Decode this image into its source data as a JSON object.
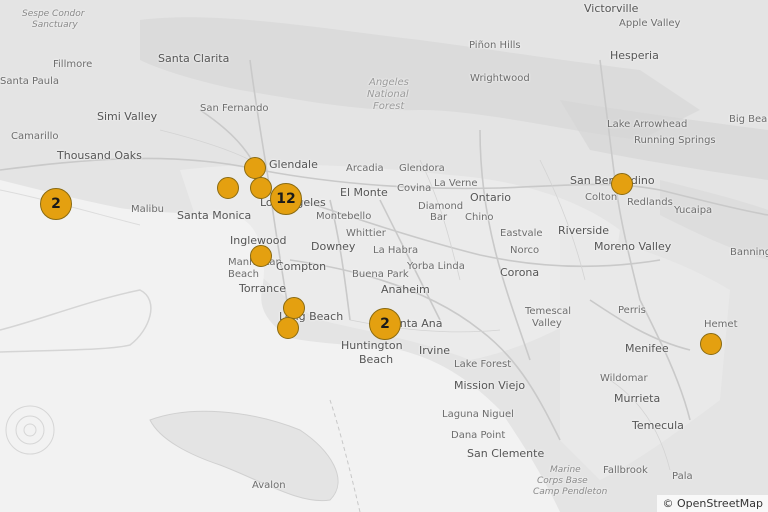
{
  "map": {
    "attribution": "© OpenStreetMap",
    "colors": {
      "land": "#e3e3e3",
      "water": "#f2f2f2",
      "marker_fill": "#e4a010",
      "marker_border": "#8a6a10"
    },
    "labels": [
      {
        "id": "sespe-condor",
        "text": "Sespe Condor"
      },
      {
        "id": "sanctuary",
        "text": "Sanctuary"
      },
      {
        "id": "fillmore",
        "text": "Fillmore"
      },
      {
        "id": "santa-paula",
        "text": "Santa Paula"
      },
      {
        "id": "santa-clarita",
        "text": "Santa Clarita"
      },
      {
        "id": "pinon-hills",
        "text": "Piñon Hills"
      },
      {
        "id": "victorville",
        "text": "Victorville"
      },
      {
        "id": "apple-valley",
        "text": "Apple Valley"
      },
      {
        "id": "hesperia",
        "text": "Hesperia"
      },
      {
        "id": "wrightwood",
        "text": "Wrightwood"
      },
      {
        "id": "angeles",
        "text": "Angeles"
      },
      {
        "id": "national",
        "text": "National"
      },
      {
        "id": "forest",
        "text": "Forest"
      },
      {
        "id": "simi-valley",
        "text": "Simi Valley"
      },
      {
        "id": "san-fernando",
        "text": "San Fernando"
      },
      {
        "id": "camarillo",
        "text": "Camarillo"
      },
      {
        "id": "lake-arrowhead",
        "text": "Lake Arrowhead"
      },
      {
        "id": "big-bear",
        "text": "Big Bear"
      },
      {
        "id": "running-springs",
        "text": "Running Springs"
      },
      {
        "id": "thousand-oaks",
        "text": "Thousand Oaks"
      },
      {
        "id": "glendale",
        "text": "Glendale"
      },
      {
        "id": "arcadia",
        "text": "Arcadia"
      },
      {
        "id": "glendora",
        "text": "Glendora"
      },
      {
        "id": "covina",
        "text": "Covina"
      },
      {
        "id": "la-verne",
        "text": "La Verne"
      },
      {
        "id": "el-monte",
        "text": "El Monte"
      },
      {
        "id": "ontario",
        "text": "Ontario"
      },
      {
        "id": "san-bernardino",
        "text": "San Bernardino"
      },
      {
        "id": "colton",
        "text": "Colton"
      },
      {
        "id": "redlands",
        "text": "Redlands"
      },
      {
        "id": "yucaipa",
        "text": "Yucaipa"
      },
      {
        "id": "malibu",
        "text": "Malibu"
      },
      {
        "id": "santa-monica",
        "text": "Santa Monica"
      },
      {
        "id": "los-angeles",
        "text": "Los Angeles"
      },
      {
        "id": "montebello",
        "text": "Montebello"
      },
      {
        "id": "diamond",
        "text": "Diamond"
      },
      {
        "id": "bar",
        "text": "Bar"
      },
      {
        "id": "chino",
        "text": "Chino"
      },
      {
        "id": "eastvale",
        "text": "Eastvale"
      },
      {
        "id": "riverside",
        "text": "Riverside"
      },
      {
        "id": "moreno-valley",
        "text": "Moreno Valley"
      },
      {
        "id": "banning",
        "text": "Banning"
      },
      {
        "id": "inglewood",
        "text": "Inglewood"
      },
      {
        "id": "downey",
        "text": "Downey"
      },
      {
        "id": "whittier",
        "text": "Whittier"
      },
      {
        "id": "la-habra",
        "text": "La Habra"
      },
      {
        "id": "norco",
        "text": "Norco"
      },
      {
        "id": "manhattan",
        "text": "Manhattan"
      },
      {
        "id": "beach-1",
        "text": "Beach"
      },
      {
        "id": "compton",
        "text": "Compton"
      },
      {
        "id": "buena-park",
        "text": "Buena Park"
      },
      {
        "id": "yorba-linda",
        "text": "Yorba Linda"
      },
      {
        "id": "corona",
        "text": "Corona"
      },
      {
        "id": "torrance",
        "text": "Torrance"
      },
      {
        "id": "anaheim",
        "text": "Anaheim"
      },
      {
        "id": "long-beach",
        "text": "Long Beach"
      },
      {
        "id": "santa-ana",
        "text": "Santa Ana"
      },
      {
        "id": "temescal",
        "text": "Temescal"
      },
      {
        "id": "valley",
        "text": "Valley"
      },
      {
        "id": "perris",
        "text": "Perris"
      },
      {
        "id": "hemet",
        "text": "Hemet"
      },
      {
        "id": "huntington",
        "text": "Huntington"
      },
      {
        "id": "beach-2",
        "text": "Beach"
      },
      {
        "id": "irvine",
        "text": "Irvine"
      },
      {
        "id": "lake-forest",
        "text": "Lake Forest"
      },
      {
        "id": "menifee",
        "text": "Menifee"
      },
      {
        "id": "mission-viejo",
        "text": "Mission Viejo"
      },
      {
        "id": "wildomar",
        "text": "Wildomar"
      },
      {
        "id": "murrieta",
        "text": "Murrieta"
      },
      {
        "id": "laguna-niguel",
        "text": "Laguna Niguel"
      },
      {
        "id": "temecula",
        "text": "Temecula"
      },
      {
        "id": "dana-point",
        "text": "Dana Point"
      },
      {
        "id": "san-clemente",
        "text": "San Clemente"
      },
      {
        "id": "marine",
        "text": "Marine"
      },
      {
        "id": "corps-base",
        "text": "Corps Base"
      },
      {
        "id": "camp-pendleton",
        "text": "Camp Pendleton"
      },
      {
        "id": "fallbrook",
        "text": "Fallbrook"
      },
      {
        "id": "pala",
        "text": "Pala"
      },
      {
        "id": "avalon",
        "text": "Avalon"
      }
    ],
    "markers": [
      {
        "id": "malibu-coast-cluster",
        "count": "2"
      },
      {
        "id": "glendale-point",
        "count": ""
      },
      {
        "id": "hollywood-point",
        "count": ""
      },
      {
        "id": "la-north-point",
        "count": ""
      },
      {
        "id": "los-angeles-cluster",
        "count": "12"
      },
      {
        "id": "inglewood-point",
        "count": ""
      },
      {
        "id": "long-beach-point-1",
        "count": ""
      },
      {
        "id": "long-beach-point-2",
        "count": ""
      },
      {
        "id": "santa-ana-cluster",
        "count": "2"
      },
      {
        "id": "san-bernardino-point",
        "count": ""
      },
      {
        "id": "hemet-point",
        "count": ""
      }
    ]
  }
}
